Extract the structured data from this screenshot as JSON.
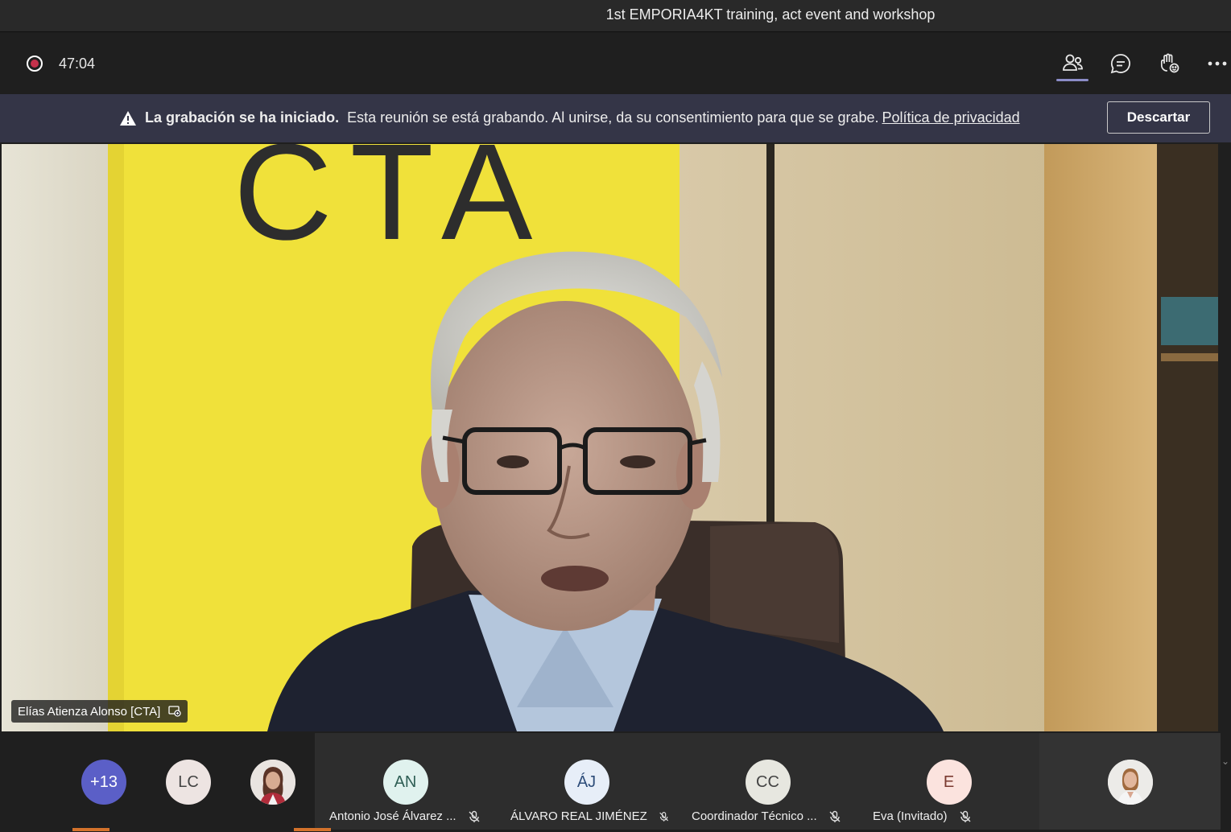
{
  "window": {
    "title": "1st EMPORIA4KT training, act event and workshop"
  },
  "meeting": {
    "recording_indicator_icon": "record-icon",
    "timer": "47:04",
    "toolbar": [
      {
        "name": "participants",
        "icon": "people-icon",
        "active": true
      },
      {
        "name": "chat",
        "icon": "chat-icon",
        "active": false
      },
      {
        "name": "reactions",
        "icon": "raise-hand-icon",
        "active": false
      },
      {
        "name": "more",
        "icon": "more-icon",
        "active": false
      }
    ]
  },
  "banner": {
    "bold": "La grabación se ha iniciado.",
    "text": "Esta reunión se está grabando. Al unirse, da su consentimiento para que se grabe.",
    "link": "Política de privacidad",
    "dismiss": "Descartar"
  },
  "main_video": {
    "speaker": "Elías Atienza Alonso [CTA]",
    "logo_text": "CTA"
  },
  "tray": {
    "overflow": "+13",
    "participants": [
      {
        "initials": "LC"
      },
      {
        "initials": "AN",
        "name": "Antonio José Álvarez ...",
        "muted": true
      },
      {
        "initials": "ÁJ",
        "name": "ÁLVARO REAL JIMÉNEZ",
        "muted": true
      },
      {
        "initials": "CC",
        "name": "Coordinador Técnico ...",
        "muted": true
      },
      {
        "initials": "E",
        "name": "Eva (Invitado)",
        "muted": true
      }
    ]
  },
  "colors": {
    "accent": "#8b8cc7",
    "recording": "#c4314b",
    "banner_bg": "#343547",
    "overflow_avatar": "#6264a7"
  }
}
